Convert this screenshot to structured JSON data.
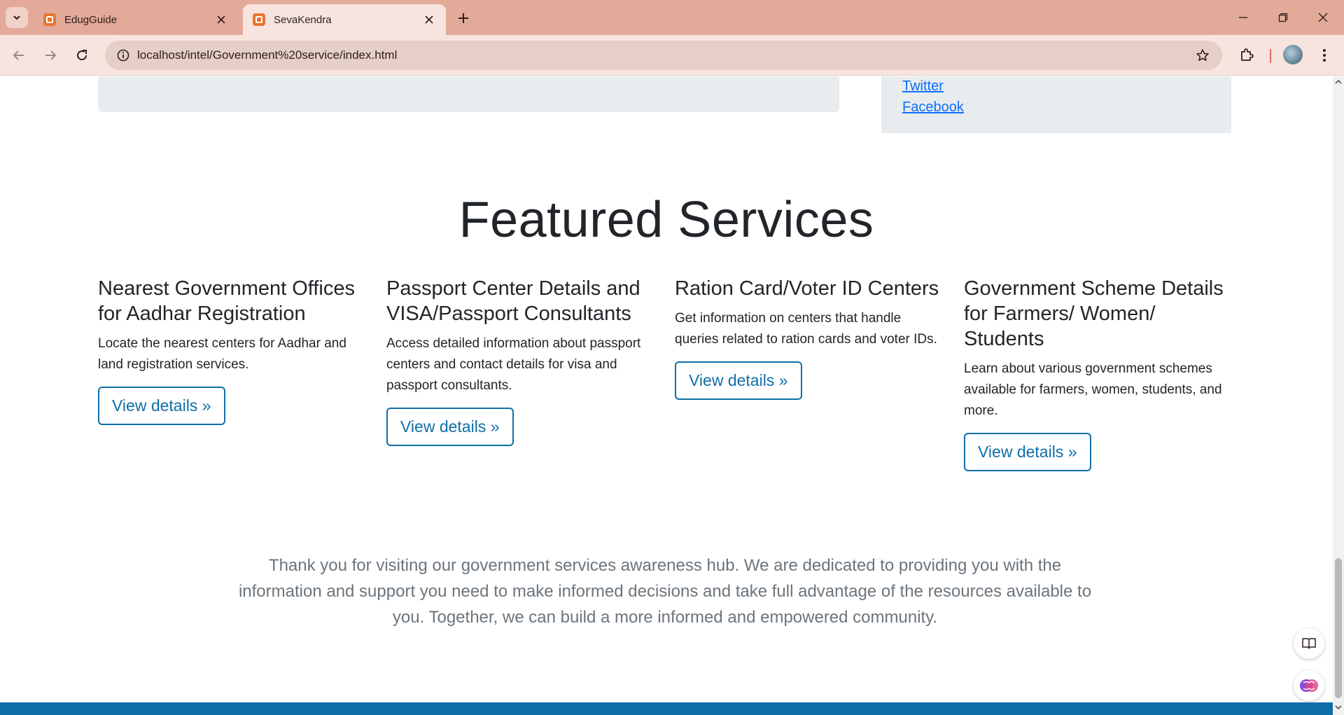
{
  "browser": {
    "tabs": [
      {
        "title": "EdugGuide",
        "active": false
      },
      {
        "title": "SevaKendra",
        "active": true
      }
    ],
    "url": "localhost/intel/Government%20service/index.html"
  },
  "sidebar": {
    "links": [
      "Twitter",
      "Facebook"
    ]
  },
  "featured": {
    "heading": "Featured Services",
    "services": [
      {
        "title": "Nearest Government Offices for Aadhar Registration",
        "description": "Locate the nearest centers for Aadhar and land registration services.",
        "button": "View details »"
      },
      {
        "title": "Passport Center Details and VISA/Passport Consultants",
        "description": "Access detailed information about passport centers and contact details for visa and passport consultants.",
        "button": "View details »"
      },
      {
        "title": "Ration Card/Voter ID Centers",
        "description": "Get information on centers that handle queries related to ration cards and voter IDs.",
        "button": "View details »"
      },
      {
        "title": "Government Scheme Details for Farmers/ Women/ Students",
        "description": "Learn about various government schemes available for farmers, women, students, and more.",
        "button": "View details »"
      }
    ]
  },
  "closing": {
    "text": "Thank you for visiting our government services awareness hub. We are dedicated to providing you with the information and support you need to make informed decisions and take full advantage of the resources available to you. Together, we can build a more informed and empowered community."
  },
  "colors": {
    "tabbar": "#e3a999",
    "toolbar": "#f7e4de",
    "accent": "#0f6ea8",
    "link": "#0d6efd",
    "panel": "#e9ecef"
  },
  "icons": [
    "tab-search-icon",
    "xampp-favicon-icon",
    "close-icon",
    "plus-icon",
    "minimize-icon",
    "restore-icon",
    "back-arrow-icon",
    "forward-arrow-icon",
    "reload-icon",
    "site-info-icon",
    "star-icon",
    "extensions-icon",
    "profile-avatar",
    "kebab-menu-icon",
    "reading-mode-icon",
    "assistant-icon"
  ]
}
